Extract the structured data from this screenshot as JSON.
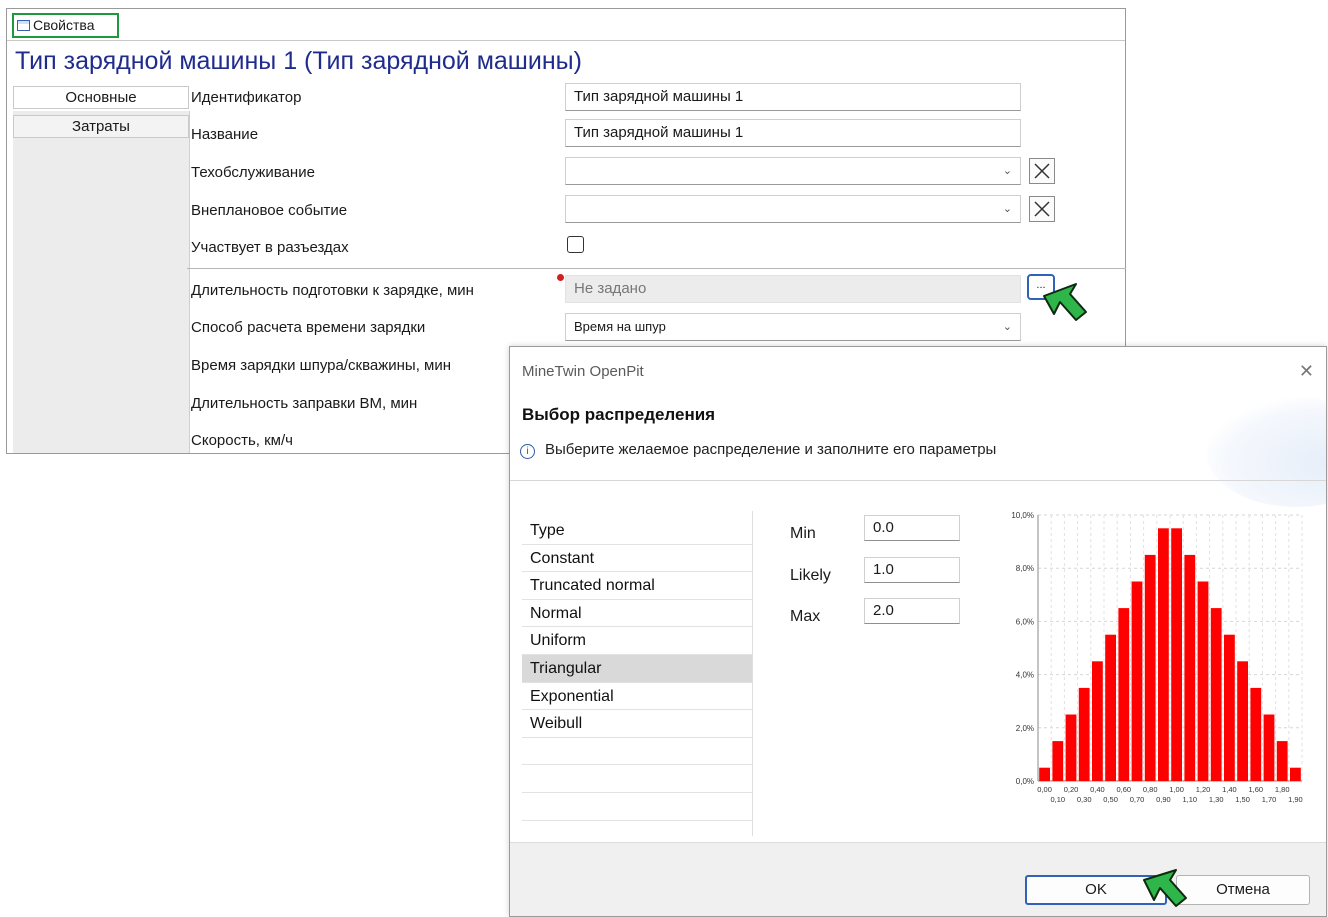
{
  "props_panel": {
    "tab_label": "Свойства",
    "title": "Тип зарядной машины 1 (Тип зарядной машины)",
    "side_tabs": [
      "Основные",
      "Затраты"
    ],
    "rows": {
      "identifier": {
        "label": "Идентификатор",
        "value": "Тип зарядной машины 1"
      },
      "name": {
        "label": "Название",
        "value": "Тип зарядной машины 1"
      },
      "maintenance": {
        "label": "Техобслуживание",
        "value": ""
      },
      "unplanned_event": {
        "label": "Внеплановое событие",
        "value": ""
      },
      "participates": {
        "label": "Участвует в разъездах",
        "checked": false
      },
      "prep_duration": {
        "label": "Длительность подготовки к зарядке, мин",
        "value": "Не задано",
        "browse_label": "..."
      },
      "charge_method": {
        "label": "Способ расчета времени зарядки",
        "value": "Время на шпур"
      },
      "charge_time": {
        "label": "Время зарядки шпура/скважины, мин"
      },
      "refuel_duration": {
        "label": "Длительность заправки ВМ, мин"
      },
      "speed": {
        "label": "Скорость, км/ч"
      }
    }
  },
  "dialog": {
    "window_title": "MineTwin OpenPit",
    "heading": "Выбор распределения",
    "info_text": "Выберите желаемое распределение и заполните его параметры",
    "distributions": [
      "Type",
      "Constant",
      "Truncated normal",
      "Normal",
      "Uniform",
      "Triangular",
      "Exponential",
      "Weibull",
      "",
      "",
      "",
      ""
    ],
    "selected_distribution": "Triangular",
    "params": [
      {
        "label": "Min",
        "value": "0.0"
      },
      {
        "label": "Likely",
        "value": "1.0"
      },
      {
        "label": "Max",
        "value": "2.0"
      }
    ],
    "ok_label": "OK",
    "cancel_label": "Отмена"
  },
  "colors": {
    "title_blue": "#1f2c8e",
    "bar_red": "#ff0000",
    "tab_border_green": "#1e9a3c",
    "ok_border_blue": "#2f62b8"
  },
  "chart_data": {
    "type": "bar",
    "categories": [
      "0,00",
      "0,10",
      "0,20",
      "0,30",
      "0,40",
      "0,50",
      "0,60",
      "0,70",
      "0,80",
      "0,90",
      "1,00",
      "1,10",
      "1,20",
      "1,30",
      "1,40",
      "1,50",
      "1,60",
      "1,70",
      "1,80",
      "1,90"
    ],
    "values": [
      0.5,
      1.5,
      2.5,
      3.5,
      4.5,
      5.5,
      6.5,
      7.5,
      8.5,
      9.5,
      9.5,
      8.5,
      7.5,
      6.5,
      5.5,
      4.5,
      3.5,
      2.5,
      1.5,
      0.5
    ],
    "y_unit": "%",
    "ylim": [
      0,
      10
    ],
    "y_ticks": [
      "0,0%",
      "2,0%",
      "4,0%",
      "6,0%",
      "8,0%",
      "10,0%"
    ],
    "x_labels_row1": [
      "0,00",
      "0,20",
      "0,40",
      "0,60",
      "0,80",
      "1,00",
      "1,20",
      "1,40",
      "1,60",
      "1,80"
    ],
    "x_labels_row2": [
      "0,10",
      "0,30",
      "0,50",
      "0,70",
      "0,90",
      "1,10",
      "1,30",
      "1,50",
      "1,70",
      "1,90"
    ],
    "grid": true,
    "bar_color": "#ff0000",
    "title": "",
    "xlabel": "",
    "ylabel": ""
  }
}
